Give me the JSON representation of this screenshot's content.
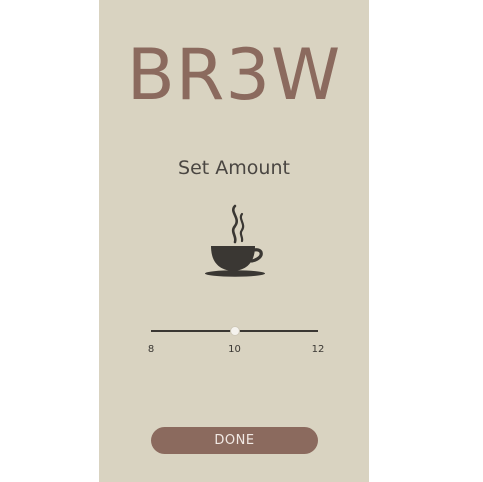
{
  "app": {
    "logo": "BR3W"
  },
  "screen": {
    "heading": "Set Amount"
  },
  "icons": {
    "cup": "coffee-cup-icon"
  },
  "slider": {
    "min": 8,
    "max": 12,
    "value": 10,
    "min_label": "8",
    "mid_label": "10",
    "max_label": "12"
  },
  "actions": {
    "done_label": "DONE"
  },
  "colors": {
    "background": "#d9d3c1",
    "brand": "#8b6a5e",
    "text_dark": "#4a4642",
    "icon": "#3a3733"
  }
}
